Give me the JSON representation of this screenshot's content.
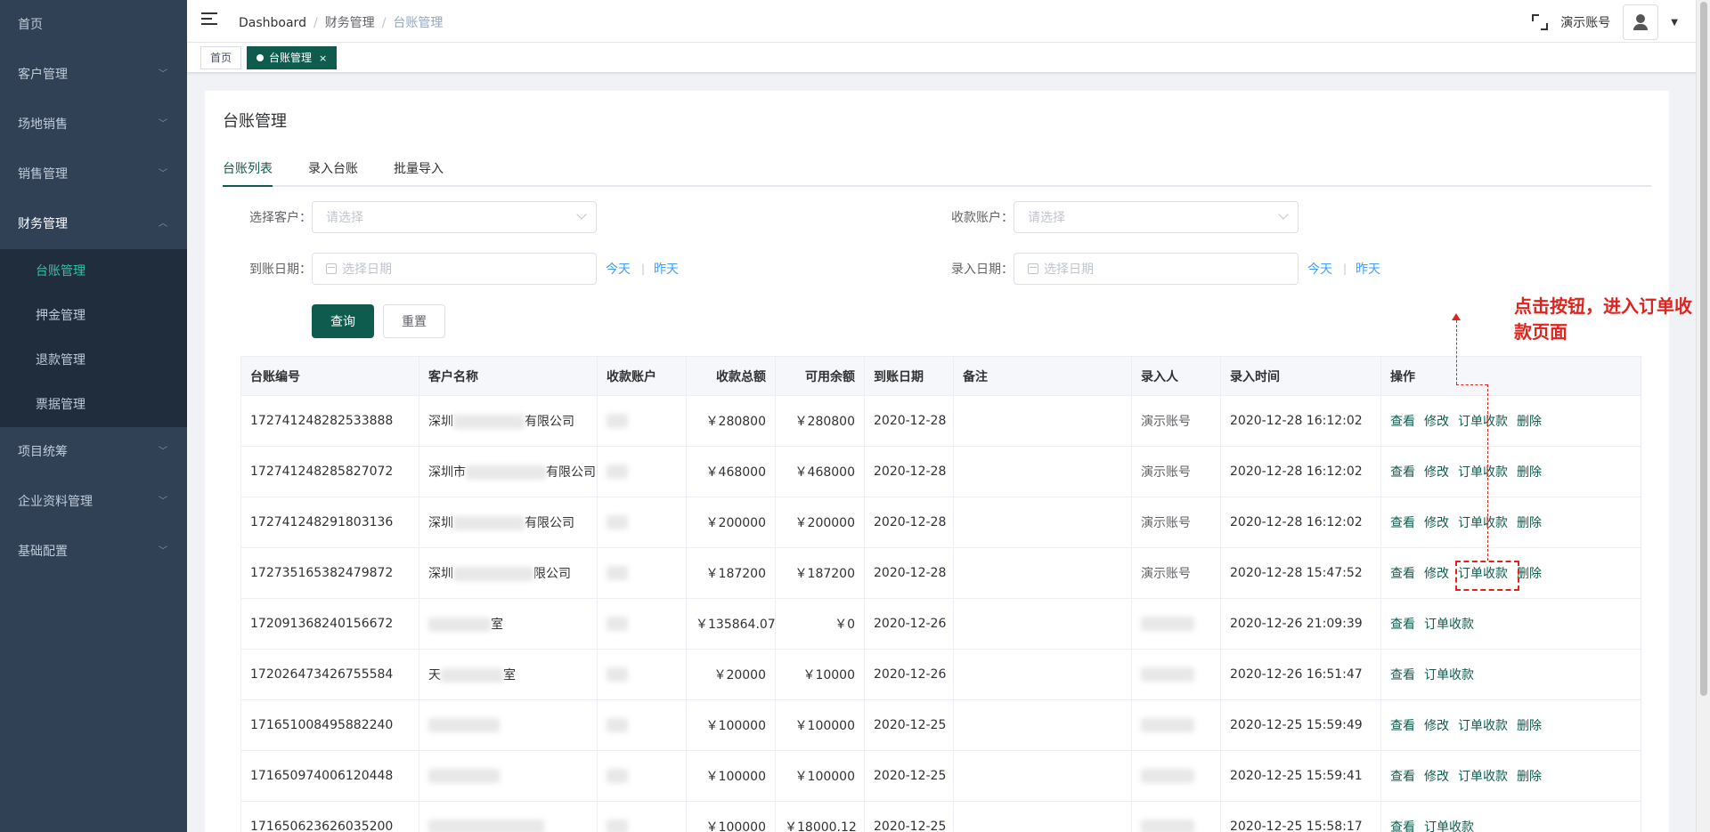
{
  "sidebar": {
    "items": [
      {
        "label": "首页",
        "has_chevron": false
      },
      {
        "label": "客户管理",
        "has_chevron": true
      },
      {
        "label": "场地销售",
        "has_chevron": true
      },
      {
        "label": "销售管理",
        "has_chevron": true
      },
      {
        "label": "财务管理",
        "has_chevron": true,
        "expanded": true
      }
    ],
    "sub_items": [
      {
        "label": "台账管理",
        "active": true
      },
      {
        "label": "押金管理"
      },
      {
        "label": "退款管理"
      },
      {
        "label": "票据管理"
      }
    ],
    "items_after": [
      {
        "label": "项目统筹"
      },
      {
        "label": "企业资料管理"
      },
      {
        "label": "基础配置"
      }
    ]
  },
  "navbar": {
    "breadcrumb": [
      "Dashboard",
      "财务管理",
      "台账管理"
    ],
    "account_name": "演示账号"
  },
  "tags": {
    "home": "首页",
    "active": "台账管理",
    "close": "×"
  },
  "page": {
    "title": "台账管理",
    "tabs": [
      "台账列表",
      "录入台账",
      "批量导入"
    ]
  },
  "filters": {
    "customer_label": "选择客户：",
    "customer_placeholder": "请选择",
    "account_label": "收款账户：",
    "account_placeholder": "请选择",
    "arrival_date_label": "到账日期：",
    "arrival_date_placeholder": "选择日期",
    "entry_date_label": "录入日期：",
    "entry_date_placeholder": "选择日期",
    "today": "今天",
    "yesterday": "昨天",
    "sep": "|",
    "query_button": "查询",
    "reset_button": "重置"
  },
  "annotation": {
    "text": "点击按钮，进入订单收款页面",
    "color": "#e0231c"
  },
  "table": {
    "columns": [
      "台账编号",
      "客户名称",
      "收款账户",
      "收款总额",
      "可用余额",
      "到账日期",
      "备注",
      "录入人",
      "录入时间",
      "操作"
    ],
    "rows": [
      {
        "id": "172741248282533888",
        "customer": "深圳",
        "customer_tail": "有限公司",
        "amount": "￥280800",
        "balance": "￥280800",
        "date": "2020-12-28",
        "entered_by": "演示账号",
        "time": "2020-12-28 16:12:02",
        "ops": [
          "查看",
          "修改",
          "订单收款",
          "删除"
        ]
      },
      {
        "id": "172741248285827072",
        "customer": "深圳市",
        "customer_tail": "有限公司",
        "amount": "￥468000",
        "balance": "￥468000",
        "date": "2020-12-28",
        "entered_by": "演示账号",
        "time": "2020-12-28 16:12:02",
        "ops": [
          "查看",
          "修改",
          "订单收款",
          "删除"
        ]
      },
      {
        "id": "172741248291803136",
        "customer": "深圳",
        "customer_tail": "有限公司",
        "amount": "￥200000",
        "balance": "￥200000",
        "date": "2020-12-28",
        "entered_by": "演示账号",
        "time": "2020-12-28 16:12:02",
        "ops": [
          "查看",
          "修改",
          "订单收款",
          "删除"
        ]
      },
      {
        "id": "172735165382479872",
        "customer": "深圳",
        "customer_tail": "限公司",
        "amount": "￥187200",
        "balance": "￥187200",
        "date": "2020-12-28",
        "entered_by": "演示账号",
        "time": "2020-12-28 15:47:52",
        "ops": [
          "查看",
          "修改",
          "订单收款",
          "删除"
        ]
      },
      {
        "id": "172091368240156672",
        "customer": "",
        "customer_tail": "室",
        "amount": "￥135864.07",
        "balance": "￥0",
        "date": "2020-12-26",
        "entered_by": "",
        "time": "2020-12-26 21:09:39",
        "ops": [
          "查看",
          "订单收款"
        ]
      },
      {
        "id": "172026473426755584",
        "customer": "天",
        "customer_tail": "室",
        "amount": "￥20000",
        "balance": "￥10000",
        "date": "2020-12-26",
        "entered_by": "",
        "time": "2020-12-26 16:51:47",
        "ops": [
          "查看",
          "订单收款"
        ]
      },
      {
        "id": "171651008495882240",
        "customer": "",
        "customer_tail": "",
        "amount": "￥100000",
        "balance": "￥100000",
        "date": "2020-12-25",
        "entered_by": "",
        "time": "2020-12-25 15:59:49",
        "ops": [
          "查看",
          "修改",
          "订单收款",
          "删除"
        ]
      },
      {
        "id": "171650974006120448",
        "customer": "",
        "customer_tail": "",
        "amount": "￥100000",
        "balance": "￥100000",
        "date": "2020-12-25",
        "entered_by": "",
        "time": "2020-12-25 15:59:41",
        "ops": [
          "查看",
          "修改",
          "订单收款",
          "删除"
        ]
      },
      {
        "id": "171650623626035200",
        "customer": "",
        "customer_tail": "",
        "amount": "￥100000",
        "balance": "￥18000.12",
        "date": "2020-12-25",
        "entered_by": "",
        "time": "2020-12-25 15:58:17",
        "ops": [
          "查看",
          "订单收款"
        ]
      }
    ]
  }
}
